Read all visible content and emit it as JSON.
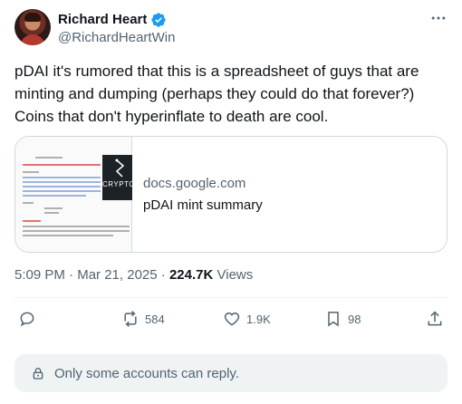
{
  "author": {
    "display_name": "Richard Heart",
    "handle": "@RichardHeartWin",
    "verified": true
  },
  "tweet": {
    "text": "pDAI it's rumored that this is a spreadsheet of guys that are\nminting and dumping (perhaps they could do that forever?)\nCoins that don't hyperinflate to death are cool."
  },
  "card": {
    "domain": "docs.google.com",
    "title": "pDAI mint summary",
    "thumbnail_brand": "CRYPTO"
  },
  "meta": {
    "time": "5:09 PM",
    "date": "Mar 21, 2025",
    "separator": "·",
    "views_count": "224.7K",
    "views_label": "Views"
  },
  "actions": {
    "reply_count": "",
    "retweet_count": "584",
    "like_count": "1.9K",
    "bookmark_count": "98"
  },
  "reply_notice": {
    "text": "Only some accounts can reply."
  },
  "colors": {
    "text_primary": "#0f1419",
    "text_secondary": "#536471",
    "verified_blue": "#1d9bf0",
    "border": "#cfd9de",
    "notice_bg": "#eff3f4"
  }
}
